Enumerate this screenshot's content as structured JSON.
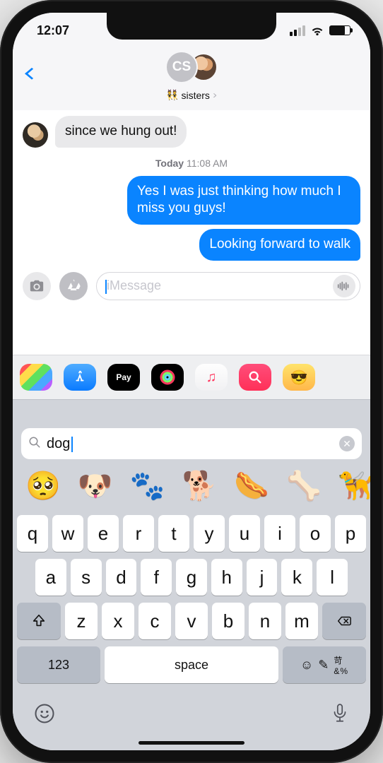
{
  "status": {
    "time": "12:07"
  },
  "chat": {
    "avatar_initials": "CS",
    "name_emoji": "👯",
    "name": "sisters",
    "incoming": "since we hung out!",
    "timestamp_day": "Today",
    "timestamp_time": "11:08 AM",
    "out1": "Yes I was just thinking how much I miss you guys!",
    "out2": "Looking forward to walk"
  },
  "compose": {
    "placeholder": "iMessage"
  },
  "apps": {
    "pay_label": "Pay",
    "music_glyph": "♫"
  },
  "emoji_search": {
    "value": "dog"
  },
  "emoji_results": [
    "🥺",
    "🐶",
    "🐾",
    "🐕",
    "🌭",
    "🦴",
    "🦮"
  ],
  "keyboard": {
    "row1": [
      "q",
      "w",
      "e",
      "r",
      "t",
      "y",
      "u",
      "i",
      "o",
      "p"
    ],
    "row2": [
      "a",
      "s",
      "d",
      "f",
      "g",
      "h",
      "j",
      "k",
      "l"
    ],
    "row3": [
      "z",
      "x",
      "c",
      "v",
      "b",
      "n",
      "m"
    ],
    "num": "123",
    "space": "space"
  }
}
